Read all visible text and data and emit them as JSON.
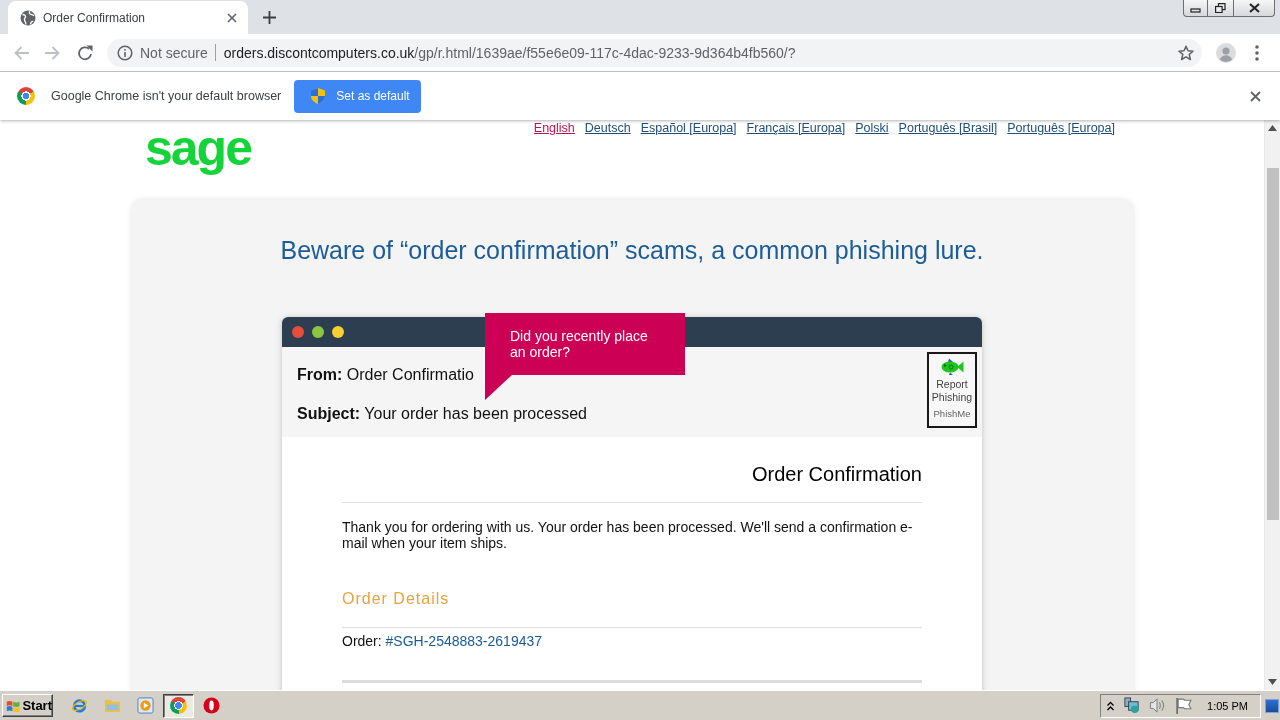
{
  "browser": {
    "tab": {
      "title": "Order Confirmation"
    },
    "navigation": [
      {
        "kind": "back",
        "disabled": true
      },
      {
        "kind": "forward",
        "disabled": true
      },
      {
        "kind": "reload",
        "disabled": false
      }
    ],
    "address_bar": {
      "security": "Not secure",
      "domain": "orders.discontcomputers.co.uk",
      "path": "/gp/r.html/1639ae/f55e6e09-117c-4dac-9233-9d364b4fb560/?"
    },
    "infobar": {
      "message": "Google Chrome isn't your default browser",
      "button": "Set as default"
    }
  },
  "page": {
    "logo": "sage",
    "languages": [
      {
        "label": "English",
        "selected": true
      },
      {
        "label": "Deutsch",
        "selected": false
      },
      {
        "label": "Español [Europa]",
        "selected": false
      },
      {
        "label": "Français [Europa]",
        "selected": false
      },
      {
        "label": "Polski",
        "selected": false
      },
      {
        "label": "Português [Brasil]",
        "selected": false
      },
      {
        "label": "Português [Europa]",
        "selected": false
      }
    ],
    "heading": "Beware of “order confirmation” scams, a common phishing lure.",
    "email": {
      "from": "**From:** Order Confirmatio",
      "subject": "**Subject:** Your order has been processed",
      "callout": "Did you recently place an order?",
      "report_button": {
        "label": "Report Phishing",
        "brand": "PhishMe"
      },
      "title": "Order Confirmation",
      "message": "Thank you for ordering with us. Your order has been processed. We'll send a confirmation e-mail when your item ships.",
      "section_title": "Order Details",
      "order_label": "Order:",
      "order_number": "#SGH-2548883-2619437"
    }
  },
  "taskbar": {
    "start": "Start",
    "apps": [
      {
        "kind": "ie",
        "selected": false
      },
      {
        "kind": "folder",
        "selected": false
      },
      {
        "kind": "media",
        "selected": false
      },
      {
        "kind": "chrome",
        "selected": true
      },
      {
        "kind": "opera",
        "selected": false
      }
    ],
    "clock": "1:05 PM"
  }
}
